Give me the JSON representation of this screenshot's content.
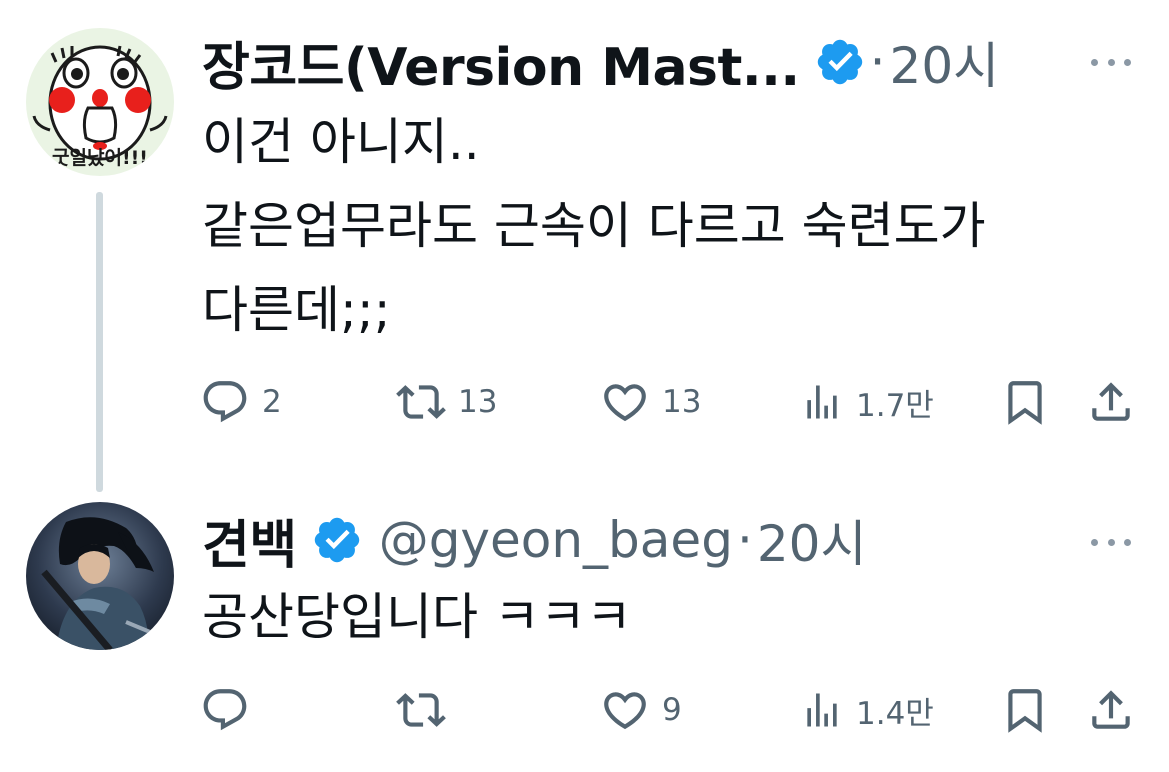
{
  "tweets": [
    {
      "author": {
        "name": "장코드(Version Mast...",
        "handle": "",
        "verified": true
      },
      "time": "20시",
      "text_lines": [
        "이건 아니지..",
        "같은업무라도 근속이 다르고 숙련도가",
        "다른데;;;"
      ],
      "stats": {
        "replies": "2",
        "retweets": "13",
        "likes": "13",
        "views": "1.7만"
      },
      "avatar_text": "굿일났어!!!"
    },
    {
      "author": {
        "name": "견백",
        "handle": "@gyeon_baeg",
        "verified": true
      },
      "time": "20시",
      "text_lines": [
        "공산당입니다 ㅋㅋㅋ"
      ],
      "stats": {
        "replies": "",
        "retweets": "",
        "likes": "9",
        "views": "1.4만"
      }
    }
  ],
  "separator_dot": "·",
  "icons": {
    "reply": "speech-bubble-icon",
    "retweet": "retweet-arrows-icon",
    "like": "heart-icon",
    "views": "bar-chart-icon",
    "bookmark": "bookmark-icon",
    "share": "share-upload-icon",
    "more": "more-dots-icon",
    "verified": "verified-badge-icon"
  },
  "colors": {
    "verified_blue": "#1d9bf0",
    "muted_text": "#536471",
    "thread_line": "#cfd9de"
  }
}
